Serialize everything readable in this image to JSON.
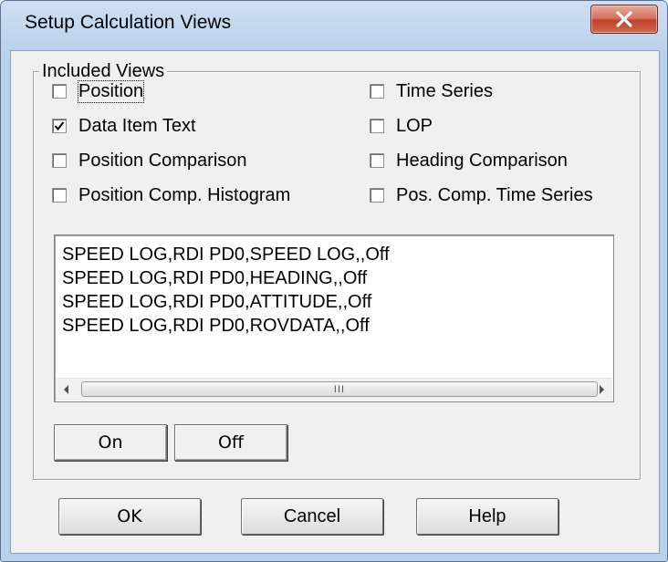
{
  "window": {
    "title": "Setup Calculation Views",
    "close_icon": "close-icon"
  },
  "group": {
    "legend": "Included Views",
    "checkboxes": [
      {
        "label": "Position",
        "checked": false
      },
      {
        "label": "Time Series",
        "checked": false
      },
      {
        "label": "Data Item Text",
        "checked": true
      },
      {
        "label": "LOP",
        "checked": false
      },
      {
        "label": "Position Comparison",
        "checked": false
      },
      {
        "label": "Heading Comparison",
        "checked": false
      },
      {
        "label": "Position Comp. Histogram",
        "checked": false
      },
      {
        "label": "Pos. Comp. Time Series",
        "checked": false
      }
    ],
    "list_items": [
      "SPEED LOG,RDI PD0,SPEED LOG,,Off",
      "SPEED LOG,RDI PD0,HEADING,,Off",
      "SPEED LOG,RDI PD0,ATTITUDE,,Off",
      "SPEED LOG,RDI PD0,ROVDATA,,Off"
    ],
    "scroll_grip": "III",
    "on_label": "On",
    "off_label": "Off"
  },
  "buttons": {
    "ok": "OK",
    "cancel": "Cancel",
    "help": "Help"
  }
}
